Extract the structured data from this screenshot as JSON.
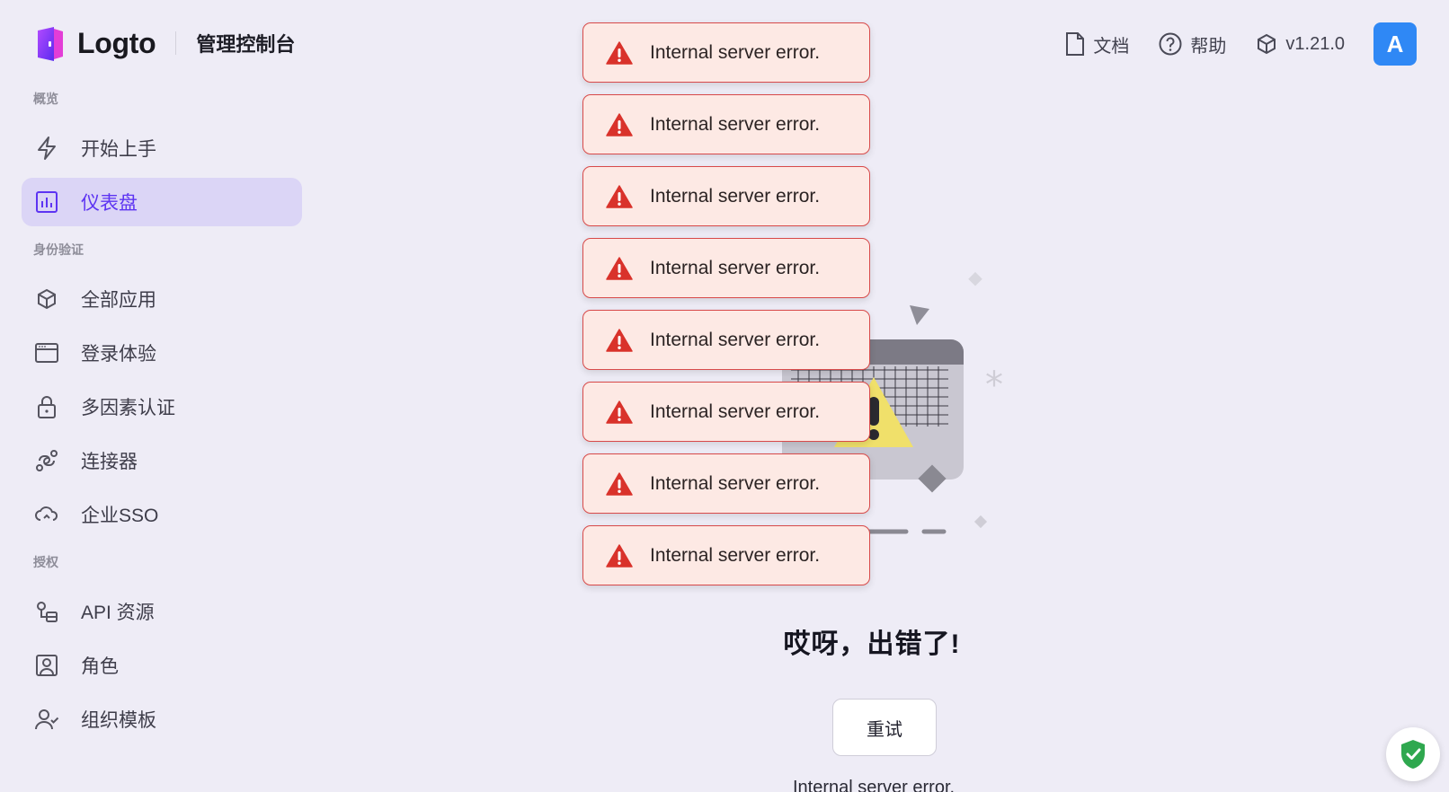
{
  "brand": {
    "name": "Logto",
    "console_title": "管理控制台"
  },
  "header": {
    "links": [
      {
        "label": "文档",
        "icon": "document-icon"
      },
      {
        "label": "帮助",
        "icon": "help-icon"
      },
      {
        "label": "v1.21.0",
        "icon": "package-icon"
      }
    ],
    "avatar_initial": "A"
  },
  "sidebar": {
    "sections": [
      {
        "title": "概览",
        "items": [
          {
            "label": "开始上手",
            "icon": "lightning-icon"
          },
          {
            "label": "仪表盘",
            "icon": "chart-icon",
            "active": true
          }
        ]
      },
      {
        "title": "身份验证",
        "items": [
          {
            "label": "全部应用",
            "icon": "cube-icon"
          },
          {
            "label": "登录体验",
            "icon": "window-icon"
          },
          {
            "label": "多因素认证",
            "icon": "lock-icon"
          },
          {
            "label": "连接器",
            "icon": "connector-icon"
          },
          {
            "label": "企业SSO",
            "icon": "cloud-icon"
          }
        ]
      },
      {
        "title": "授权",
        "items": [
          {
            "label": "API 资源",
            "icon": "api-icon"
          },
          {
            "label": "角色",
            "icon": "role-icon"
          },
          {
            "label": "组织模板",
            "icon": "org-icon"
          }
        ]
      }
    ]
  },
  "toasts": [
    "Internal server error.",
    "Internal server error.",
    "Internal server error.",
    "Internal server error.",
    "Internal server error.",
    "Internal server error.",
    "Internal server error.",
    "Internal server error."
  ],
  "main": {
    "error_title": "哎呀，出错了!",
    "retry_label": "重试",
    "error_detail": "Internal server error."
  },
  "colors": {
    "accent": "#5d34f2",
    "toast_border": "#d84a4a",
    "avatar": "#2f88f5"
  }
}
